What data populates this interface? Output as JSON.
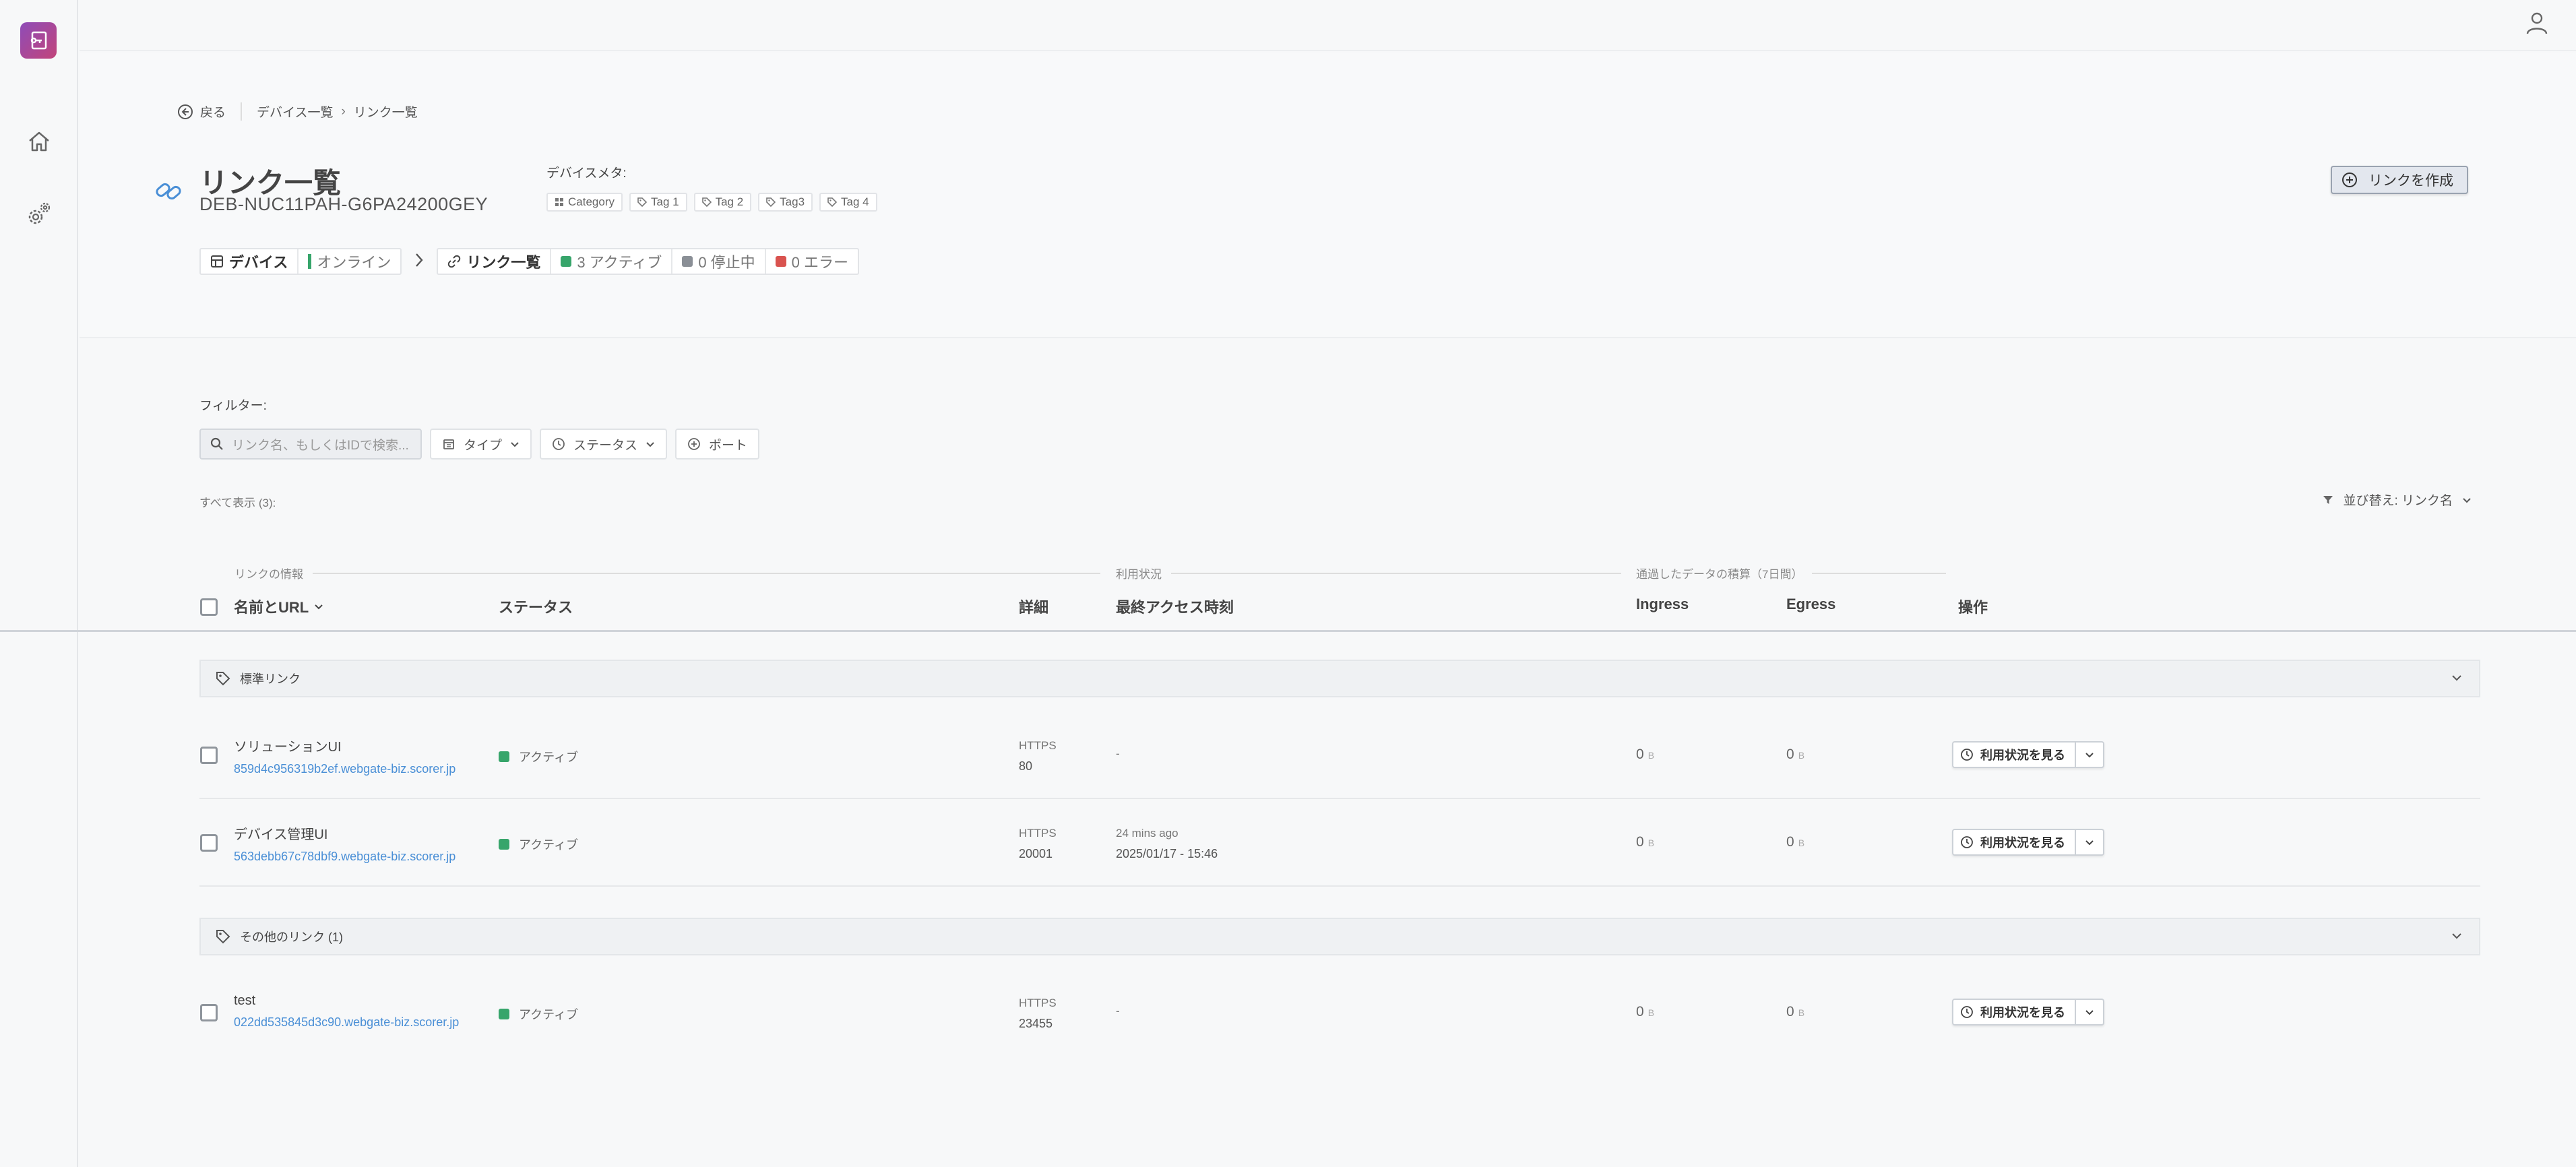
{
  "nav": {
    "items": [
      {
        "name": "home"
      },
      {
        "name": "settings"
      }
    ]
  },
  "breadcrumb": {
    "back": "戻る",
    "path1": "デバイス一覧",
    "path2": "リンク一覧"
  },
  "header": {
    "title": "リンク一覧",
    "device_id": "DEB-NUC11PAH-G6PA24200GEY",
    "meta_label": "デバイスメタ:",
    "tags": [
      "Category",
      "Tag 1",
      "Tag 2",
      "Tag3",
      "Tag 4"
    ],
    "create_button": "リンクを作成"
  },
  "status": {
    "device_label": "デバイス",
    "device_state": "オンライン",
    "links_label": "リンク一覧",
    "active": "3 アクティブ",
    "stopped": "0 停止中",
    "error": "0 エラー"
  },
  "filter": {
    "label": "フィルター:",
    "search_placeholder": "リンク名、もしくはIDで検索...",
    "type": "タイプ",
    "status": "ステータス",
    "port": "ポート",
    "count": "すべて表示 (3):",
    "sort": "並び替え: リンク名"
  },
  "table": {
    "group_heads": {
      "info": "リンクの情報",
      "usage": "利用状況",
      "data": "通過したデータの積算（7日間）"
    },
    "columns": {
      "name": "名前とURL",
      "status": "ステータス",
      "detail": "詳細",
      "access": "最終アクセス時刻",
      "ingress": "Ingress",
      "egress": "Egress",
      "ops": "操作"
    },
    "groups": [
      {
        "label": "標準リンク",
        "rows": [
          {
            "name": "ソリューションUI",
            "url": "859d4c956319b2ef.webgate-biz.scorer.jp",
            "status": "アクティブ",
            "protocol": "HTTPS",
            "port": "80",
            "access1": "-",
            "access2": "",
            "ingress": "0",
            "egress": "0",
            "unit": "B",
            "action": "利用状況を見る"
          },
          {
            "name": "デバイス管理UI",
            "url": "563debb67c78dbf9.webgate-biz.scorer.jp",
            "status": "アクティブ",
            "protocol": "HTTPS",
            "port": "20001",
            "access1": "24 mins ago",
            "access2": "2025/01/17 - 15:46",
            "ingress": "0",
            "egress": "0",
            "unit": "B",
            "action": "利用状況を見る"
          }
        ]
      },
      {
        "label": "その他のリンク (1)",
        "rows": [
          {
            "name": "test",
            "url": "022dd535845d3c90.webgate-biz.scorer.jp",
            "status": "アクティブ",
            "protocol": "HTTPS",
            "port": "23455",
            "access1": "-",
            "access2": "",
            "ingress": "0",
            "egress": "0",
            "unit": "B",
            "action": "利用状況を見る"
          }
        ]
      }
    ]
  },
  "colors": {
    "accent": "#4a8fd6",
    "active": "#37a56b",
    "stopped": "#8a8f96",
    "error": "#d9534f",
    "logo_start": "#8e4cb8",
    "logo_end": "#c2447a"
  }
}
